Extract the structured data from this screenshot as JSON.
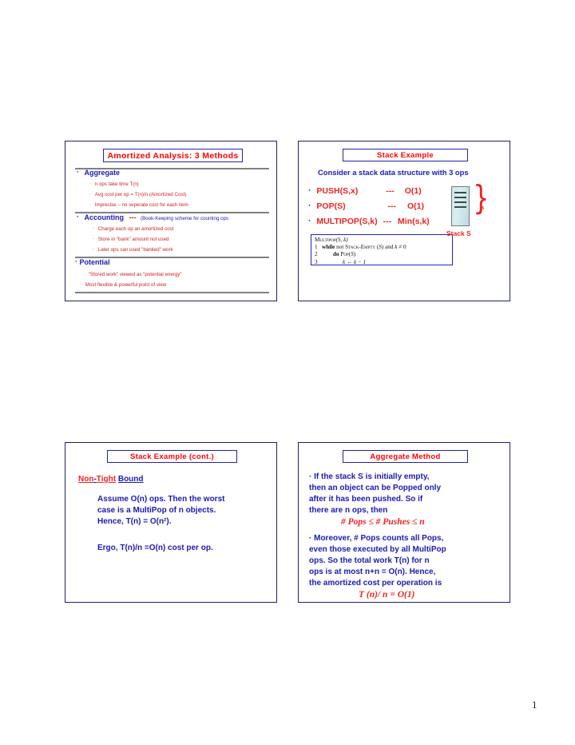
{
  "page": {
    "number": "1"
  },
  "slides": [
    {
      "id": "amortized-analysis",
      "title": "Amortized Analysis: 3 Methods",
      "sections": [
        {
          "heading": "Aggregate",
          "bullets": [
            "n ops take time T(n)",
            "Avg cost per op = T(n)/n  (Amortized Cost)",
            "Imprecise – no seperate cost for each item"
          ]
        },
        {
          "heading": "Accounting",
          "heading_dashes": "---",
          "heading_note": "(Book-Keeping scheme for counting ops",
          "bullets": [
            "Charge each op an amortized cost",
            "Store in \"bank\" amount not used",
            "Later ops can used \"banked\" work"
          ]
        },
        {
          "heading": "Potential",
          "bullets": [
            "\"Stored work\" viewed as \"potential energy\"",
            "Most flexible & powerful point of view"
          ]
        }
      ]
    },
    {
      "id": "stack-example",
      "title": "Stack Example",
      "intro": "Consider a stack data structure with 3 ops",
      "ops": [
        {
          "name": "PUSH(S,x)",
          "dashes": "---",
          "cost": "O(1)"
        },
        {
          "name": "POP(S)",
          "dashes": "---",
          "cost": "O(1)"
        },
        {
          "name": "MULTIPOP(S,k)",
          "dashes": "---",
          "cost": "Min(s,k)"
        }
      ],
      "code": {
        "signature_name": "Multipop",
        "signature_args": "(S, k)",
        "lines": [
          {
            "num": "1",
            "text": "while not Stack-Empty (S) and k ≠ 0"
          },
          {
            "num": "2",
            "text": "do Pop(S)"
          },
          {
            "num": "3",
            "text": "k ← k − 1"
          }
        ]
      },
      "stack_graphic": {
        "brace_label": "s",
        "caption": "Stack S"
      }
    },
    {
      "id": "stack-example-cont",
      "title": "Stack Example (cont.)",
      "subheading_parts": [
        "Non",
        "-",
        "Tight",
        " ",
        "Bound"
      ],
      "body": [
        "Assume O(n) ops.  Then the worst",
        "case is a MultiPop of n objects.",
        "Hence, T(n) = O(n²)."
      ],
      "conclusion": "Ergo,   T(n)/n =O(n) cost per op."
    },
    {
      "id": "aggregate-method",
      "title": "Aggregate Method",
      "para1": [
        "· If the stack  S  is initially empty,",
        "then an object can be Popped only",
        "after it has been pushed.  So if",
        "there are n ops, then"
      ],
      "formula1": "# Pops ≤ # Pushes ≤ n",
      "para2": [
        "· Moreover, # Pops  counts all Pops,",
        "even those executed by all MultiPop",
        "ops.  So the total work T(n) for n",
        "ops is at most  n+n = O(n).   Hence,",
        "the amortized cost per operation is"
      ],
      "formula2": "T (n)/ n = O(1)"
    }
  ],
  "colors": {
    "title_text": "#ff0000",
    "title_border": "#2222aa",
    "slide_border": "#1f1f6e",
    "blue": "#1a1ab4",
    "red": "#ee2222",
    "rule": "#808080"
  }
}
